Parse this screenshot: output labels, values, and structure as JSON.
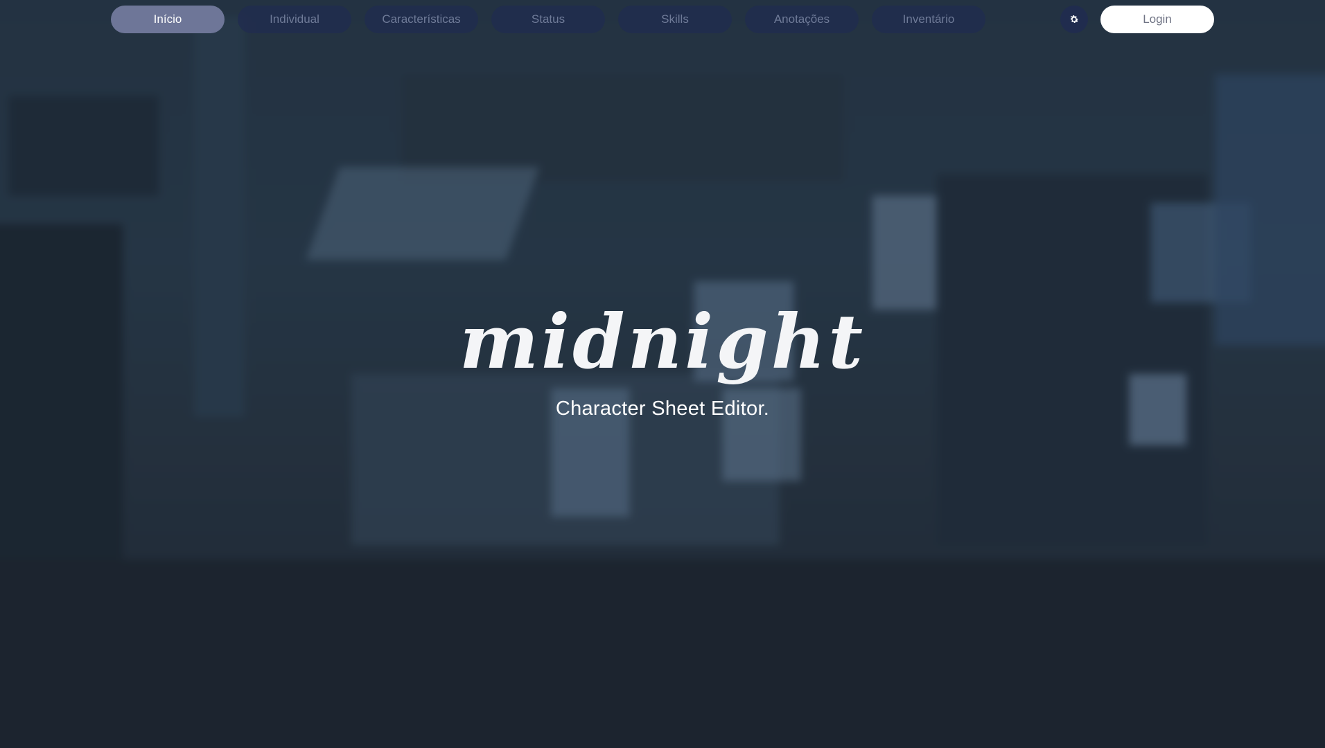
{
  "nav": {
    "items": [
      {
        "label": "Início",
        "active": true
      },
      {
        "label": "Individual",
        "active": false
      },
      {
        "label": "Características",
        "active": false
      },
      {
        "label": "Status",
        "active": false
      },
      {
        "label": "Skills",
        "active": false
      },
      {
        "label": "Anotações",
        "active": false
      },
      {
        "label": "Inventário",
        "active": false
      }
    ],
    "settings_icon": "gear-icon",
    "login_label": "Login"
  },
  "hero": {
    "logo_text": "midnight",
    "tagline": "Character Sheet Editor."
  },
  "colors": {
    "nav_active_bg": "#6e7698",
    "nav_inactive_bg": "#202c50",
    "login_bg": "#ffffff",
    "overlay": "#1e2a38"
  }
}
